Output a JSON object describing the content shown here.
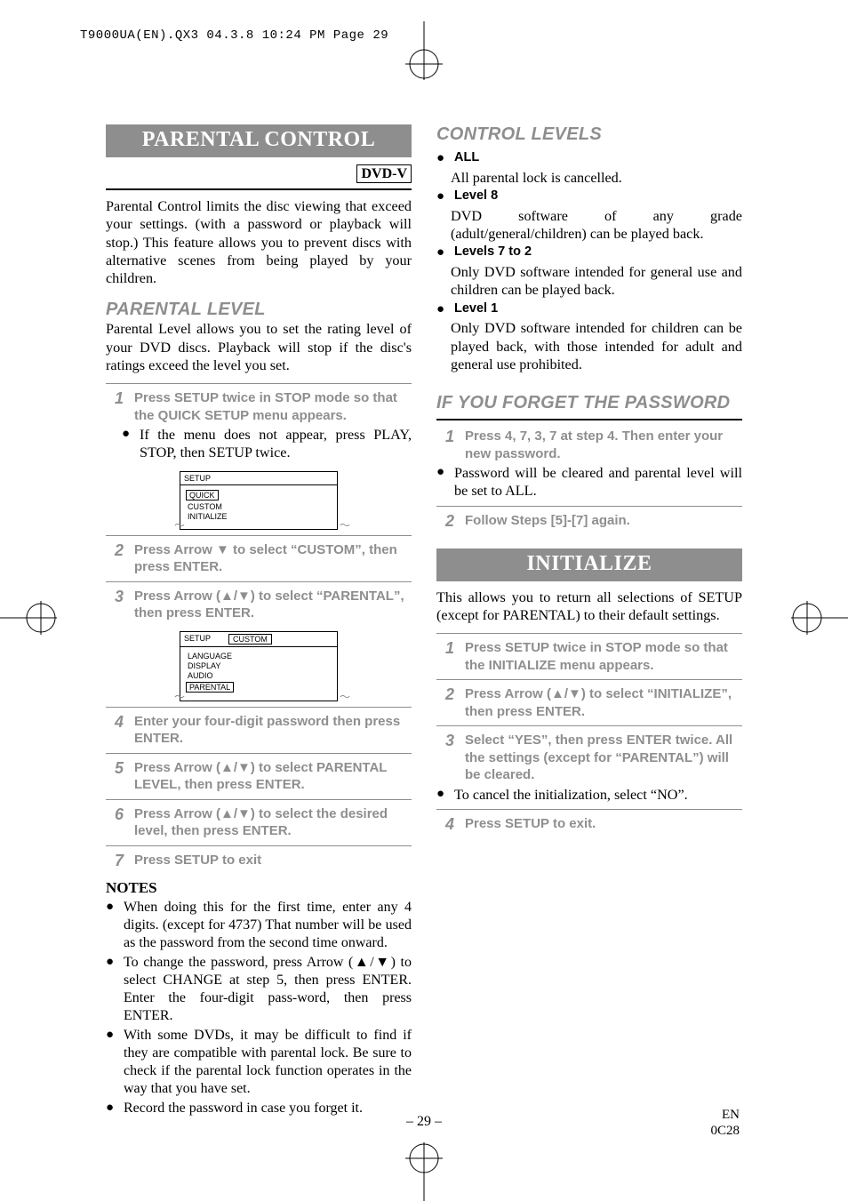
{
  "header_line": "T9000UA(EN).QX3  04.3.8  10:24 PM  Page 29",
  "left": {
    "title": "PARENTAL CONTROL",
    "dvd_badge": "DVD-V",
    "intro": "Parental Control limits the disc viewing that exceed your settings. (with a password or playback will stop.) This feature allows you to prevent discs with alternative scenes from being played by your children.",
    "sub1": "PARENTAL LEVEL",
    "sub1_intro": "Parental Level allows you to set the rating level of your DVD discs. Playback will stop if the disc's ratings exceed the level you set.",
    "step1": "Press SETUP twice in STOP mode so that the QUICK SETUP menu appears.",
    "step1_note": "If the menu does not appear, press PLAY, STOP, then SETUP twice.",
    "osd1": {
      "crumb1": "SETUP",
      "items": [
        "QUICK",
        "CUSTOM",
        "INITIALIZE"
      ],
      "sel": 0
    },
    "step2": "Press Arrow ▼ to select “CUSTOM”, then press ENTER.",
    "step3": "Press Arrow (▲/▼) to select “PARENTAL”, then press ENTER.",
    "osd2": {
      "crumb1": "SETUP",
      "crumb2": "CUSTOM",
      "items": [
        "LANGUAGE",
        "DISPLAY",
        "AUDIO",
        "PARENTAL"
      ],
      "sel": 3
    },
    "step4": "Enter your four-digit password then press ENTER.",
    "step5": "Press Arrow (▲/▼) to select PARENTAL LEVEL, then press ENTER.",
    "step6": "Press Arrow (▲/▼) to select the desired level, then press ENTER.",
    "step7": "Press SETUP to exit",
    "notes_head": "NOTES",
    "notes": [
      "When doing this for the first time, enter any 4 digits. (except for 4737) That number will be used as the password from the second time onward.",
      "To change the password, press Arrow (▲/▼) to select CHANGE at step 5, then press ENTER. Enter the four-digit pass-word, then press ENTER.",
      "With some DVDs, it may be difficult to find if they are compatible with parental lock. Be sure to check if the parental lock function operates in the way that you have set.",
      "Record the password in case you forget it."
    ]
  },
  "right": {
    "control_head": "CONTROL LEVELS",
    "levels": [
      {
        "label": "ALL",
        "text": "All parental lock is cancelled."
      },
      {
        "label": "Level 8",
        "text": "DVD software of any grade (adult/general/children) can be played back."
      },
      {
        "label": "Levels 7 to 2",
        "text": "Only DVD software intended for general use and children can be played back."
      },
      {
        "label": "Level 1",
        "text": "Only DVD software intended for children can be played back, with those intended for adult and general use prohibited."
      }
    ],
    "forgot_head": "IF YOU FORGET THE PASSWORD",
    "forgot_step1": "Press 4, 7, 3, 7 at step 4. Then enter your new password.",
    "forgot_note": "Password will be cleared and parental level will be set to ALL.",
    "forgot_step2": "Follow Steps [5]-[7] again.",
    "init_title": "INITIALIZE",
    "init_intro": "This allows you to return all selections of SETUP (except for PARENTAL) to their default settings.",
    "init_step1": "Press SETUP twice in STOP mode so that the INITIALIZE menu appears.",
    "init_step2": "Press Arrow (▲/▼) to select “INITIALIZE”, then press ENTER.",
    "init_step3": "Select “YES”, then press ENTER twice. All the settings (except for “PARENTAL”) will be cleared.",
    "init_note": "To cancel the initialization, select “NO”.",
    "init_step4": "Press SETUP to exit."
  },
  "footer": {
    "page": "– 29 –",
    "lang": "EN",
    "code": "0C28"
  }
}
